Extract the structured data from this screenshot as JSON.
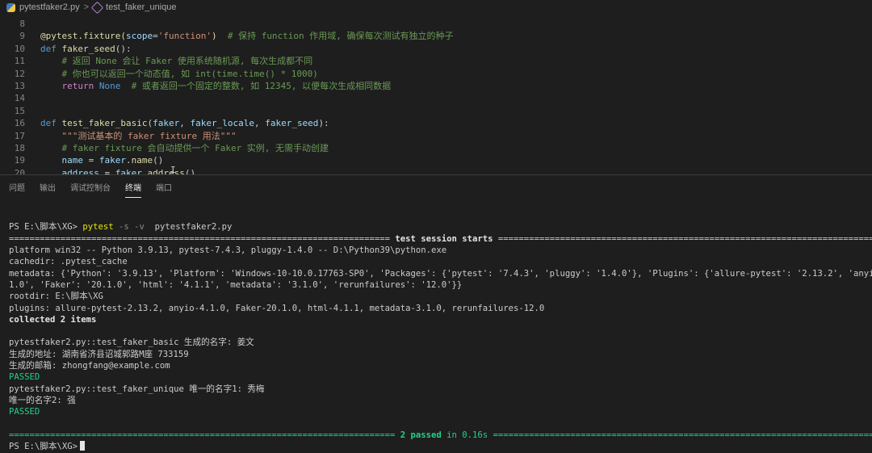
{
  "breadcrumb": {
    "file": "pytestfaker2.py",
    "sep": ">",
    "symbol": "test_faker_unique"
  },
  "editor": {
    "lines": [
      {
        "n": "8"
      },
      {
        "n": "9",
        "parts": [
          [
            "dec",
            "@pytest.fixture("
          ],
          [
            "param",
            "scope"
          ],
          [
            "",
            "="
          ],
          [
            "str",
            "'function'"
          ],
          [
            "dec",
            ")"
          ],
          [
            "cm",
            "  # 保持 function 作用域, 确保每次测试有独立的种子"
          ]
        ]
      },
      {
        "n": "10",
        "parts": [
          [
            "kw",
            "def "
          ],
          [
            "fn",
            "faker_seed"
          ],
          [
            "",
            "():"
          ]
        ]
      },
      {
        "n": "11",
        "parts": [
          [
            "cm",
            "    # 返回 None 会让 Faker 使用系统随机源, 每次生成都不同"
          ]
        ]
      },
      {
        "n": "12",
        "parts": [
          [
            "cm",
            "    # 你也可以返回一个动态值, 如 int(time.time() * 1000)"
          ]
        ]
      },
      {
        "n": "13",
        "parts": [
          [
            "ctrl",
            "    return "
          ],
          [
            "kw",
            "None"
          ],
          [
            "cm",
            "  # 或者返回一个固定的整数, 如 12345, 以便每次生成相同数据"
          ]
        ]
      },
      {
        "n": "14"
      },
      {
        "n": "15"
      },
      {
        "n": "16",
        "parts": [
          [
            "kw",
            "def "
          ],
          [
            "fn",
            "test_faker_basic"
          ],
          [
            "",
            "("
          ],
          [
            "param",
            "faker"
          ],
          [
            "",
            ", "
          ],
          [
            "param",
            "faker_locale"
          ],
          [
            "",
            ", "
          ],
          [
            "param",
            "faker_seed"
          ],
          [
            "",
            "):"
          ]
        ]
      },
      {
        "n": "17",
        "parts": [
          [
            "str",
            "    \"\"\"测试基本的 faker fixture 用法\"\"\""
          ]
        ]
      },
      {
        "n": "18",
        "parts": [
          [
            "cm",
            "    # faker fixture 会自动提供一个 Faker 实例, 无需手动创建"
          ]
        ]
      },
      {
        "n": "19",
        "parts": [
          [
            "param",
            "    name"
          ],
          [
            "",
            " = "
          ],
          [
            "param",
            "faker"
          ],
          [
            "",
            "."
          ],
          [
            "fn",
            "name"
          ],
          [
            "",
            "()"
          ]
        ]
      },
      {
        "n": "20",
        "parts": [
          [
            "param",
            "    address"
          ],
          [
            "",
            " = "
          ],
          [
            "param",
            "faker"
          ],
          [
            "",
            "."
          ],
          [
            "fn",
            "address"
          ],
          [
            "",
            "()"
          ]
        ]
      }
    ]
  },
  "panel": {
    "tabs": [
      "问题",
      "输出",
      "调试控制台",
      "终端",
      "端口"
    ],
    "active": 3
  },
  "terminal": {
    "prompt": "PS E:\\脚本\\XG>",
    "command": "pytest",
    "args": " -s -v",
    "file": "  pytestfaker2.py",
    "session_rule_left": "==========================================================================",
    "session_title": " test session starts ",
    "session_rule_right": "=======================================================================================",
    "platform": "platform win32 -- Python 3.9.13, pytest-7.4.3, pluggy-1.4.0 -- D:\\Python39\\python.exe",
    "cachedir": "cachedir: .pytest_cache",
    "metadata1": "metadata: {'Python': '3.9.13', 'Platform': 'Windows-10-10.0.17763-SP0', 'Packages': {'pytest': '7.4.3', 'pluggy': '1.4.0'}, 'Plugins': {'allure-pytest': '2.13.2', 'anyio': '4.",
    "metadata2": "1.0', 'Faker': '20.1.0', 'html': '4.1.1', 'metadata': '3.1.0', 'rerunfailures': '12.0'}}",
    "rootdir": "rootdir: E:\\脚本\\XG",
    "plugins": "plugins: allure-pytest-2.13.2, anyio-4.1.0, Faker-20.1.0, html-4.1.1, metadata-3.1.0, rerunfailures-12.0",
    "collected": "collected 2 items",
    "test1": "pytestfaker2.py::test_faker_basic 生成的名字: 姜文",
    "addr": "生成的地址: 湖南省济县诏城郭路M座 733159",
    "email": "生成的邮箱: zhongfang@example.com",
    "passed1": "PASSED",
    "test2": "pytestfaker2.py::test_faker_unique 唯一的名字1: 秀梅",
    "unique2": "唯一的名字2: 强",
    "passed2": "PASSED",
    "summary_rule_left": "===========================================================================",
    "summary_passed": " 2 passed",
    "summary_time": " in 0.16s ",
    "summary_rule_right": "========================================================================================",
    "prompt2": "PS E:\\脚本\\XG>"
  }
}
